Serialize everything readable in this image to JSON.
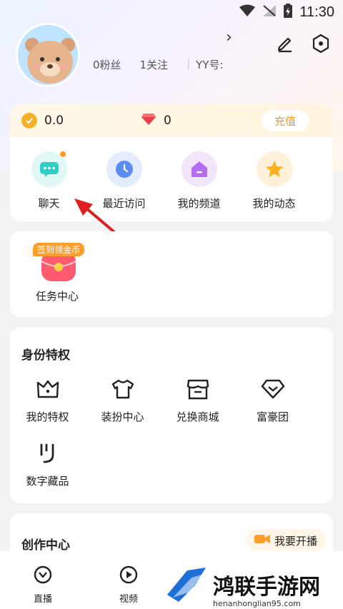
{
  "status_bar": {
    "time": "11:30"
  },
  "profile": {
    "fans": "0粉丝",
    "follows": "1关注",
    "yy_id": "YY号:"
  },
  "wallet": {
    "coins": "0.0",
    "gems": "0",
    "recharge_label": "充值"
  },
  "quick_actions": [
    {
      "label": "聊天",
      "icon": "chat-bubble-icon",
      "color": "#2ecfc6"
    },
    {
      "label": "最近访问",
      "icon": "clock-icon",
      "color": "#5a8cf2"
    },
    {
      "label": "我的频道",
      "icon": "home-channel-icon",
      "color": "#b46cf0"
    },
    {
      "label": "我的动态",
      "icon": "star-icon",
      "color": "#ffb021"
    }
  ],
  "task": {
    "badge": "签到领金币",
    "label": "任务中心"
  },
  "identity": {
    "title": "身份特权",
    "items": [
      {
        "label": "我的特权",
        "icon": "crown-icon"
      },
      {
        "label": "装扮中心",
        "icon": "shirt-icon"
      },
      {
        "label": "兑换商城",
        "icon": "shop-icon"
      },
      {
        "label": "富豪团",
        "icon": "diamond-icon"
      },
      {
        "label": "数字藏品",
        "icon": "collectible-icon"
      }
    ]
  },
  "creation": {
    "title": "创作中心",
    "live_button": "我要开播"
  },
  "bottom_nav": [
    {
      "label": "直播",
      "icon": "live-icon"
    },
    {
      "label": "视频",
      "icon": "video-icon"
    }
  ],
  "watermark": {
    "text": "鸿联手游网",
    "url": "henanhonglian95.com"
  },
  "annotation": {
    "color": "#e02020"
  }
}
